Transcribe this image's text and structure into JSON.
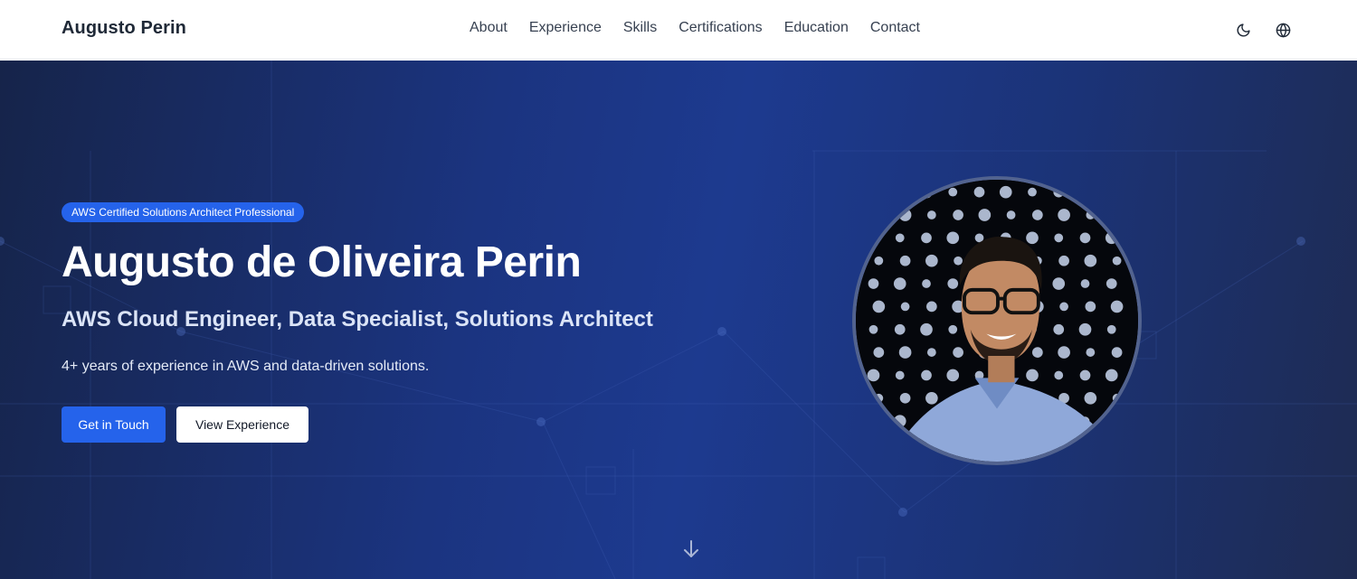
{
  "nav": {
    "brand": "Augusto Perin",
    "links": [
      "About",
      "Experience",
      "Skills",
      "Certifications",
      "Education",
      "Contact"
    ],
    "icons": [
      "moon-icon",
      "globe-icon"
    ]
  },
  "hero": {
    "badge": "AWS Certified Solutions Architect Professional",
    "name": "Augusto de Oliveira Perin",
    "subtitle": "AWS Cloud Engineer, Data Specialist, Solutions Architect",
    "description": "4+ years of experience in AWS and data-driven solutions.",
    "primary_button": "Get in Touch",
    "secondary_button": "View Experience",
    "scroll_icon": "arrow-down-icon"
  },
  "colors": {
    "accent": "#2563eb",
    "hero_dark": "#16244a",
    "hero_mid": "#1d3a8f",
    "nav_text": "#374151"
  }
}
